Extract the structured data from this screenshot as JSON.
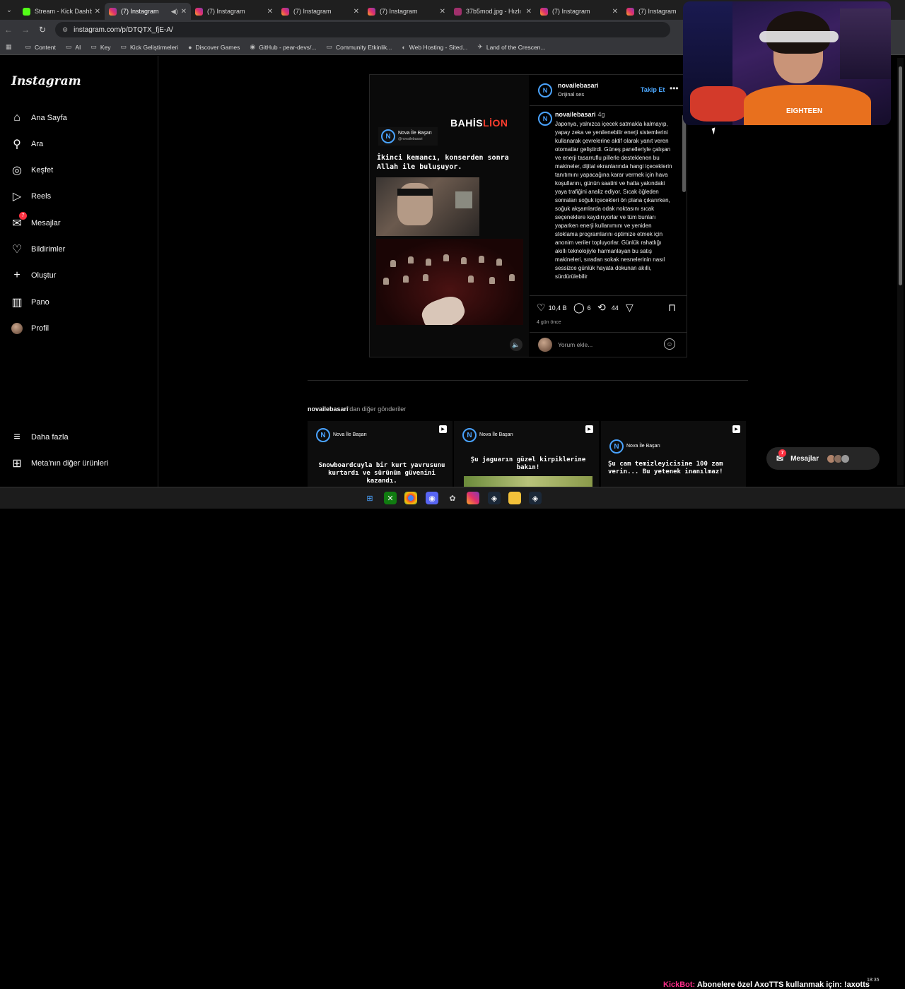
{
  "browser": {
    "tabs": [
      {
        "title": "Stream - Kick Dashbo",
        "icon": "kick"
      },
      {
        "title": "(7) Instagram",
        "icon": "instagram",
        "active": true,
        "audio": true
      },
      {
        "title": "(7) Instagram",
        "icon": "instagram"
      },
      {
        "title": "(7) Instagram",
        "icon": "instagram"
      },
      {
        "title": "(7) Instagram",
        "icon": "instagram"
      },
      {
        "title": "37b5mod.jpg - Hızlı",
        "icon": "image"
      },
      {
        "title": "(7) Instagram",
        "icon": "instagram"
      },
      {
        "title": "(7) Instagram",
        "icon": "instagram"
      }
    ],
    "url": "instagram.com/p/DTQTX_fjE-A/",
    "bookmarks": [
      "Content",
      "AI",
      "Key",
      "Kick Geliştirmeleri",
      "Discover Games",
      "GitHub - pear-devs/...",
      "Community Etkinlik...",
      "Web Hosting - Sited...",
      "Land of the Crescen..."
    ]
  },
  "sidebar": {
    "logo": "Instagram",
    "items": [
      {
        "label": "Ana Sayfa",
        "icon": "home-icon"
      },
      {
        "label": "Ara",
        "icon": "search-icon"
      },
      {
        "label": "Keşfet",
        "icon": "compass-icon"
      },
      {
        "label": "Reels",
        "icon": "reels-icon"
      },
      {
        "label": "Mesajlar",
        "icon": "messenger-icon",
        "badge": "7"
      },
      {
        "label": "Bildirimler",
        "icon": "heart-icon"
      },
      {
        "label": "Oluştur",
        "icon": "plus-icon"
      },
      {
        "label": "Pano",
        "icon": "dashboard-icon"
      },
      {
        "label": "Profil",
        "icon": "avatar"
      }
    ],
    "more": "Daha fazla",
    "meta": "Meta'nın diğer ürünleri"
  },
  "post": {
    "username": "novailebasari",
    "audio": "Orijinal ses",
    "follow": "Takip Et",
    "video": {
      "brand": "Nova İle Başarı",
      "handle": "@novailebasari",
      "sponsor_a": "BAHİS",
      "sponsor_b": "LİON",
      "caption": "İkinci kemancı, konserden sonra Allah ile buluşuyor."
    },
    "caption_age": "4g",
    "caption": "Japonya, yalnızca içecek satmakla kalmayıp, yapay zeka ve yenilenebilir enerji sistemlerini kullanarak çevrelerine aktif olarak yanıt veren otomatlar geliştirdi. Güneş panelleriyle çalışan ve enerji tasarruflu pillerle desteklenen bu makineler, dijital ekranlarında hangi içeceklerin tanıtımını yapacağına karar vermek için hava koşullarını, günün saatini ve hatta yakındaki yaya trafiğini analiz ediyor. Sıcak öğleden sonraları soğuk içecekleri ön plana çıkarırken, soğuk akşamlarda odak noktasını sıcak seçeneklere kaydırıyorlar ve tüm bunları yaparken enerji kullanımını ve yeniden stoklama programlarını optimize etmek için anonim veriler topluyorlar. Günlük rahatlığı akıllı teknolojiyle harmanlayan bu satış makineleri, sıradan sokak nesnelerinin nasıl sessizce günlük hayata dokunan akıllı, sürdürülebilir",
    "likes": "10,4 B",
    "comments": "6",
    "reposts": "44",
    "time": "4 gün önce",
    "comment_placeholder": "Yorum ekle..."
  },
  "more_posts": {
    "user": "novailebasari",
    "suffix": "'dan diğer gönderiler",
    "items": [
      {
        "caption": "Snowboardcuyla bir kurt yavrusunu kurtardı ve sürünün güvenini kazandı."
      },
      {
        "caption": "Şu jaguarın güzel kirpiklerine bakın!"
      },
      {
        "caption": "Şu cam temizleyicisine 100 zam verin... Bu yetenek inanılmaz!"
      }
    ]
  },
  "webcam": {
    "shirt_text": "EIGHTEEN"
  },
  "chat_pill": {
    "label": "Mesajlar",
    "badge": "7"
  },
  "taskbar": {
    "ticker_bot": "KickBot:",
    "ticker_text": "Abonelere özel AxoTTS kullanmak için: !axotts",
    "time": "18:35"
  },
  "colors": {
    "accent": "#4ca8ff",
    "badge": "#ff3040",
    "background": "#000000"
  }
}
